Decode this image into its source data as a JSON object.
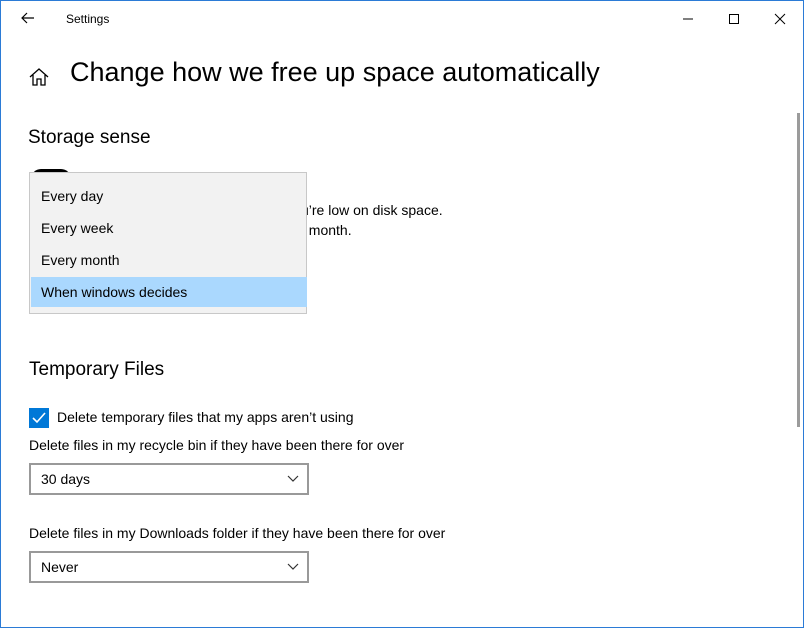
{
  "window": {
    "title": "Settings"
  },
  "page": {
    "title": "Change how we free up space automatically"
  },
  "storage_sense": {
    "section_title": "Storage sense",
    "description_line1": "u’re low on disk space.",
    "description_line2": "t month.",
    "run_dropdown": {
      "options": [
        "Every day",
        "Every week",
        "Every month",
        "When windows decides"
      ],
      "selected": "When windows decides"
    }
  },
  "temporary_files": {
    "section_title": "Temporary Files",
    "delete_temp_checkbox": {
      "label": "Delete temporary files that my apps aren’t using",
      "checked": true
    },
    "recycle_bin": {
      "label": "Delete files in my recycle bin if they have been there for over",
      "value": "30 days"
    },
    "downloads": {
      "label": "Delete files in my Downloads folder if they have been there for over",
      "value": "Never"
    }
  },
  "icons": {
    "back": "back-arrow-icon",
    "home": "home-icon",
    "minimize": "minimize-icon",
    "maximize": "maximize-icon",
    "close": "close-icon",
    "chevron": "chevron-down-icon",
    "check": "checkmark-icon"
  },
  "colors": {
    "accent": "#0078d7",
    "selected_item": "#aad8fe",
    "window_border": "#2b7bd6",
    "menu_background": "#f2f2f2"
  }
}
